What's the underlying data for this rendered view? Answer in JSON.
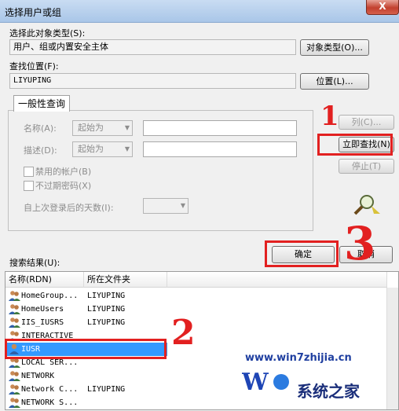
{
  "window": {
    "title": "选择用户或组",
    "close_label": "X"
  },
  "object_type": {
    "label": "选择此对象类型(S):",
    "value": "用户、组或内置安全主体",
    "button": "对象类型(O)..."
  },
  "location": {
    "label": "查找位置(F):",
    "value": "LIYUPING",
    "button": "位置(L)..."
  },
  "query": {
    "tab": "一般性查询",
    "name_label": "名称(A):",
    "name_mode": "起始为",
    "desc_label": "描述(D):",
    "desc_mode": "起始为",
    "disabled_accounts": "禁用的帐户(B)",
    "non_expiring_pw": "不过期密码(X)",
    "days_since_login": "自上次登录后的天数(I):"
  },
  "buttons": {
    "columns": "列(C)...",
    "find_now": "立即查找(N)",
    "stop": "停止(T)",
    "ok": "确定",
    "cancel": "取消"
  },
  "results": {
    "label": "搜索结果(U):",
    "columns": [
      "名称(RDN)",
      "所在文件夹"
    ],
    "rows": [
      {
        "name": "HomeGroup...",
        "folder": "LIYUPING",
        "icon": "group-icon"
      },
      {
        "name": "HomeUsers",
        "folder": "LIYUPING",
        "icon": "group-icon"
      },
      {
        "name": "IIS_IUSRS",
        "folder": "LIYUPING",
        "icon": "group-icon"
      },
      {
        "name": "INTERACTIVE",
        "folder": "",
        "icon": "group-icon"
      },
      {
        "name": "IUSR",
        "folder": "",
        "icon": "user-icon",
        "selected": true
      },
      {
        "name": "LOCAL SER...",
        "folder": "",
        "icon": "group-icon"
      },
      {
        "name": "NETWORK",
        "folder": "",
        "icon": "group-icon"
      },
      {
        "name": "Network C...",
        "folder": "LIYUPING",
        "icon": "group-icon"
      },
      {
        "name": "NETWORK S...",
        "folder": "",
        "icon": "group-icon"
      }
    ]
  },
  "annotations": {
    "one": "1",
    "two": "2",
    "three": "3"
  },
  "watermark": {
    "site": "www.win7zhijia.cn",
    "brand": "系统之家"
  }
}
